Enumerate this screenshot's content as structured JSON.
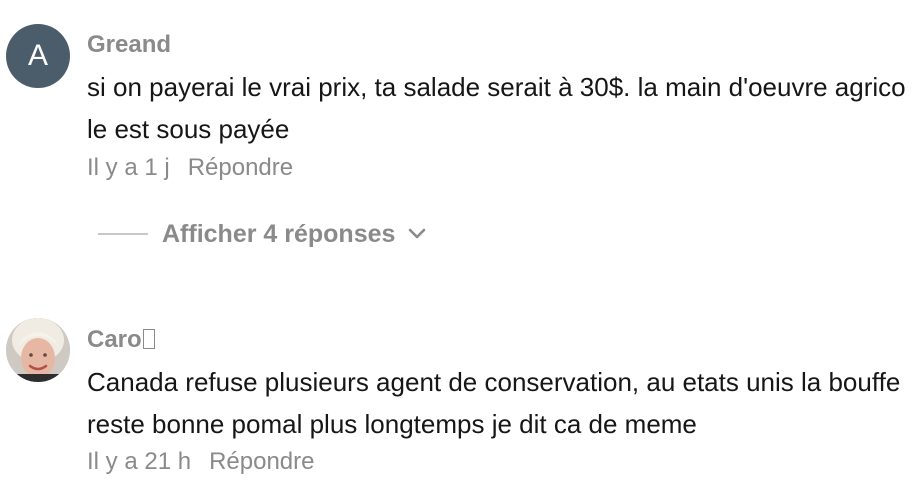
{
  "comments": [
    {
      "avatar_letter": "A",
      "avatar_color": "#4b5d6b",
      "username": "Greand",
      "text": "si on payerai le vrai prix, ta salade serait à 30$. la main d'oeuvre agricole est sous payée",
      "time": "Il y a 1 j",
      "reply_label": "Répondre",
      "view_replies_label": "Afficher 4 réponses"
    },
    {
      "avatar_type": "photo",
      "username": "Caro",
      "text": "Canada refuse plusieurs agent de conservation, au etats unis la bouffe reste bonne pomal plus longtemps je dit ca de meme",
      "time": "Il y a 21 h",
      "reply_label": "Répondre"
    }
  ],
  "colors": {
    "text_primary": "#161616",
    "text_secondary": "#8a8a8a",
    "avatar_bg": "#4b5d6b"
  },
  "icons": {
    "expand": "chevron-down-icon"
  }
}
